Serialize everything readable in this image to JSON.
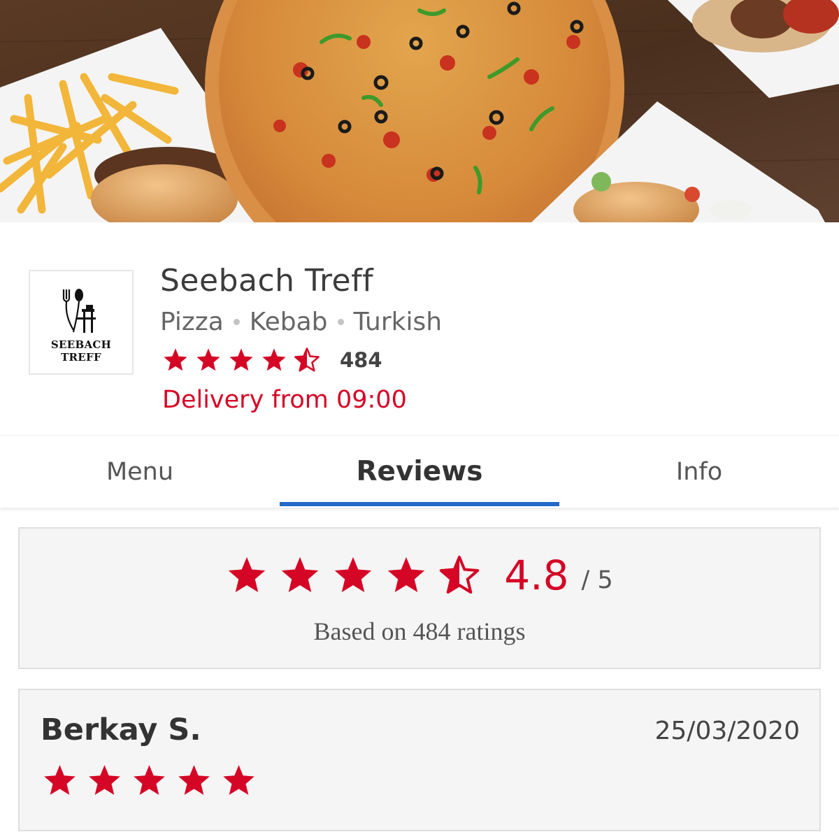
{
  "restaurant": {
    "logo_text": "SEEBACH TREFF",
    "name": "Seebach Treff",
    "cuisines": [
      "Pizza",
      "Kebab",
      "Turkish"
    ],
    "rating": 4.5,
    "rating_count": "484",
    "delivery": "Delivery from 09:00"
  },
  "tabs": [
    {
      "label": "Menu",
      "active": false
    },
    {
      "label": "Reviews",
      "active": true
    },
    {
      "label": "Info",
      "active": false
    }
  ],
  "summary": {
    "stars": 4.5,
    "average": "4.8",
    "out_of": "/ 5",
    "based_on": "Based on 484 ratings"
  },
  "reviews": [
    {
      "name": "Berkay S.",
      "date": "25/03/2020",
      "stars": 5
    }
  ],
  "colors": {
    "accent_red": "#d50525",
    "tab_indicator": "#2369c7",
    "card_bg": "#f5f5f5"
  },
  "icons": [
    "star-icon",
    "half-star-icon",
    "cutlery-logo-icon"
  ]
}
